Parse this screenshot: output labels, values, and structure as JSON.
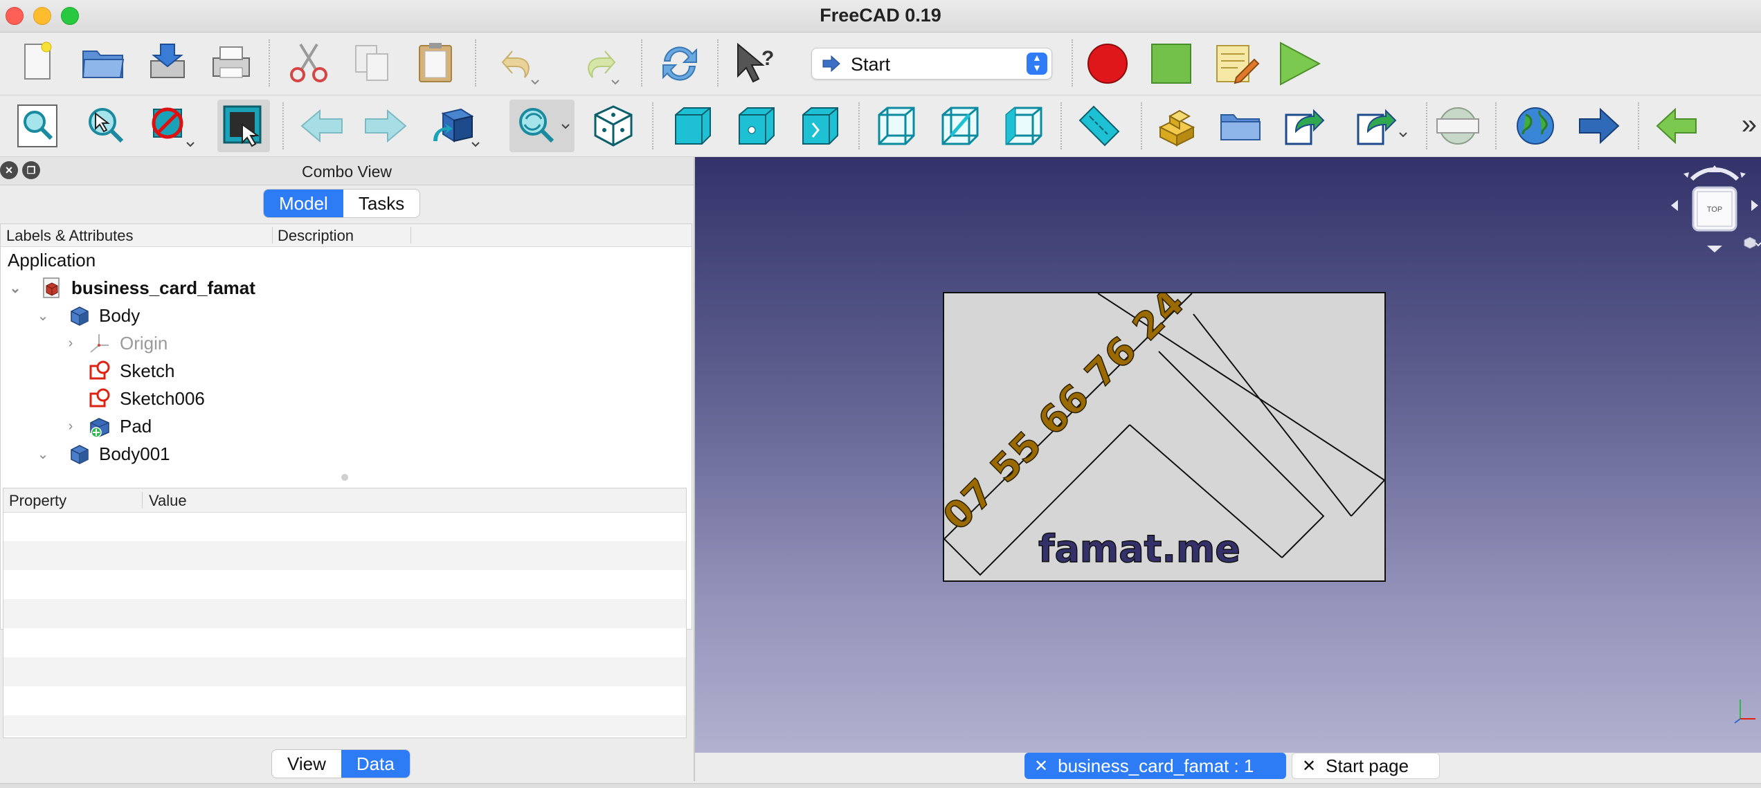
{
  "window": {
    "title": "FreeCAD 0.19"
  },
  "toolbar1": {
    "workbench": "Start",
    "icons": [
      "new-document-icon",
      "open-folder-icon",
      "save-icon",
      "print-icon",
      "cut-icon",
      "copy-icon",
      "paste-icon",
      "undo-icon",
      "redo-icon",
      "refresh-icon",
      "whats-this-icon",
      "macro-record-icon",
      "macro-stop-icon",
      "macro-edit-icon",
      "macro-run-icon"
    ]
  },
  "toolbar2": {
    "icons": [
      "fit-all-icon",
      "fit-selection-icon",
      "draw-style-icon",
      "bounding-box-icon",
      "back-icon",
      "forward-icon",
      "sync-view-icon",
      "std-view-menu-icon",
      "isometric-icon",
      "front-view-icon",
      "top-view-icon",
      "right-view-icon",
      "rear-view-icon",
      "bottom-view-icon",
      "left-view-icon",
      "measure-icon",
      "part-icon",
      "group-icon",
      "link-icon",
      "link-actions-icon",
      "web-navigation-icon",
      "web-start-icon",
      "web-forward-icon",
      "web-back-icon"
    ]
  },
  "combo_view": {
    "title": "Combo View",
    "tabs": [
      "Model",
      "Tasks"
    ],
    "active_tab": "Model",
    "tree_columns": [
      "Labels & Attributes",
      "Description"
    ],
    "tree": [
      {
        "label": "Application",
        "level": 0,
        "bold": false,
        "icon": ""
      },
      {
        "label": "business_card_famat",
        "level": 1,
        "bold": true,
        "icon": "document-icon",
        "expanded": true
      },
      {
        "label": "Body",
        "level": 2,
        "bold": false,
        "icon": "body-icon",
        "expanded": true
      },
      {
        "label": "Origin",
        "level": 3,
        "bold": false,
        "icon": "origin-icon",
        "expanded": false,
        "muted": true
      },
      {
        "label": "Sketch",
        "level": 3,
        "bold": false,
        "icon": "sketch-icon"
      },
      {
        "label": "Sketch006",
        "level": 3,
        "bold": false,
        "icon": "sketch-icon"
      },
      {
        "label": "Pad",
        "level": 3,
        "bold": false,
        "icon": "pad-icon",
        "expanded": false
      },
      {
        "label": "Body001",
        "level": 2,
        "bold": false,
        "icon": "body-icon",
        "expanded": true
      }
    ],
    "property_columns": [
      "Property",
      "Value"
    ],
    "bottom_tabs": [
      "View",
      "Data"
    ],
    "active_bottom_tab": "Data"
  },
  "viewport": {
    "card_phone": "07 55 66 76 24",
    "card_site": "famat.me",
    "navcube_face": "TOP"
  },
  "document_tabs": [
    {
      "label": "business_card_famat : 1",
      "active": true
    },
    {
      "label": "Start page",
      "active": false
    }
  ],
  "colors": {
    "accent": "#2d7cf6",
    "phone_text": "#9a6a00",
    "site_text": "#33306a",
    "viewport_top": "#33336a",
    "viewport_bottom": "#b2b1cf"
  }
}
